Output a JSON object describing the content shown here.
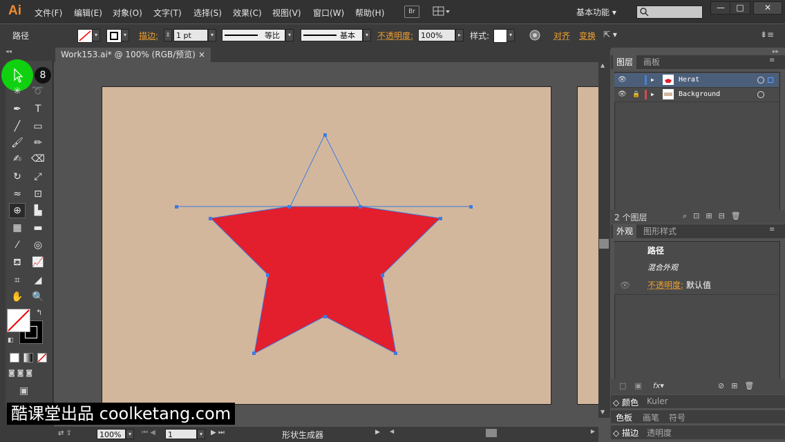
{
  "app": {
    "logo": "Ai",
    "bridge": "Br"
  },
  "menu": [
    "文件(F)",
    "编辑(E)",
    "对象(O)",
    "文字(T)",
    "选择(S)",
    "效果(C)",
    "视图(V)",
    "窗口(W)",
    "帮助(H)"
  ],
  "workspace": "基本功能",
  "window_controls": [
    "—",
    "□",
    "✕"
  ],
  "control_bar": {
    "object_type": "路径",
    "stroke_label": "描边:",
    "stroke_weight": "1 pt",
    "profile_label": "等比",
    "brush_label": "基本",
    "opacity_label": "不透明度:",
    "opacity_value": "100%",
    "style_label": "样式:",
    "align_label": "对齐",
    "transform_label": "变换"
  },
  "document": {
    "tab_title": "Work153.ai* @ 100% (RGB/预览)",
    "close": "×"
  },
  "status_bar": {
    "zoom": "100%",
    "page": "1",
    "tool_name": "形状生成器"
  },
  "toolbar": {
    "badge": "8"
  },
  "layers_panel": {
    "tabs": [
      "图层",
      "画板"
    ],
    "layers": [
      {
        "name": "Herat",
        "selected": true,
        "color": "#4a7fd6"
      },
      {
        "name": "Background",
        "selected": false,
        "color": "#d64a4a"
      }
    ],
    "footer_count": "2 个图层"
  },
  "appearance_panel": {
    "tabs": [
      "外观",
      "图形样式"
    ],
    "title": "路径",
    "mixed": "混合外观",
    "opacity_label": "不透明度:",
    "opacity_value": "默认值"
  },
  "bottom_panels": [
    {
      "tabs": [
        "颜色",
        "Kuler"
      ]
    },
    {
      "tabs": [
        "色板",
        "画笔",
        "符号"
      ]
    },
    {
      "tabs": [
        "描边",
        "透明度"
      ]
    }
  ],
  "watermark": "酷课堂出品 coolketang.com",
  "colors": {
    "star_fill": "#e31e2d",
    "artboard": "#d3b79d",
    "selection": "#3d7be0",
    "accent": "#f0a030"
  }
}
